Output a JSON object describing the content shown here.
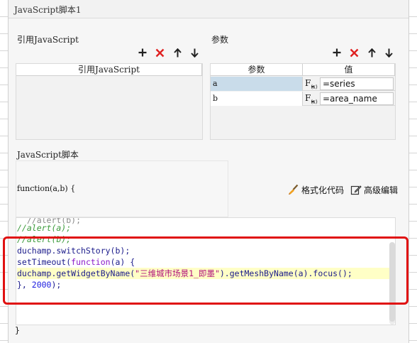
{
  "dialog": {
    "title": "JavaScript脚本1"
  },
  "imports": {
    "label": "引用JavaScript",
    "column_header": "引用JavaScript",
    "rows": []
  },
  "params": {
    "label": "参数",
    "columns": [
      "参数",
      "值"
    ],
    "rows": [
      {
        "name": "a",
        "value": "=series",
        "selected": true
      },
      {
        "name": "b",
        "value": "=area_name",
        "selected": false
      }
    ],
    "fx_label": "F(x)"
  },
  "script": {
    "label": "JavaScript脚本",
    "signature": "function(a,b) {",
    "format_label": "格式化代码",
    "advanced_label": "高级编辑",
    "closing": "}",
    "lines": [
      "//alert(a);",
      "//alert(b);",
      "duchamp.switchStory(b);",
      "setTimeout(function(a) {",
      "duchamp.getWidgetByName(\"三维城市场景1_即墨\").getMeshByName(a).focus();",
      "}, 2000);"
    ]
  },
  "colors": {
    "delete_red": "#e02020",
    "highlight_frame": "#e01010",
    "selected_cell": "#c9dcea",
    "current_line": "#ffffc6"
  },
  "icons": [
    "add-icon",
    "delete-icon",
    "move-up-icon",
    "move-down-icon",
    "brush-icon",
    "edit-icon"
  ]
}
